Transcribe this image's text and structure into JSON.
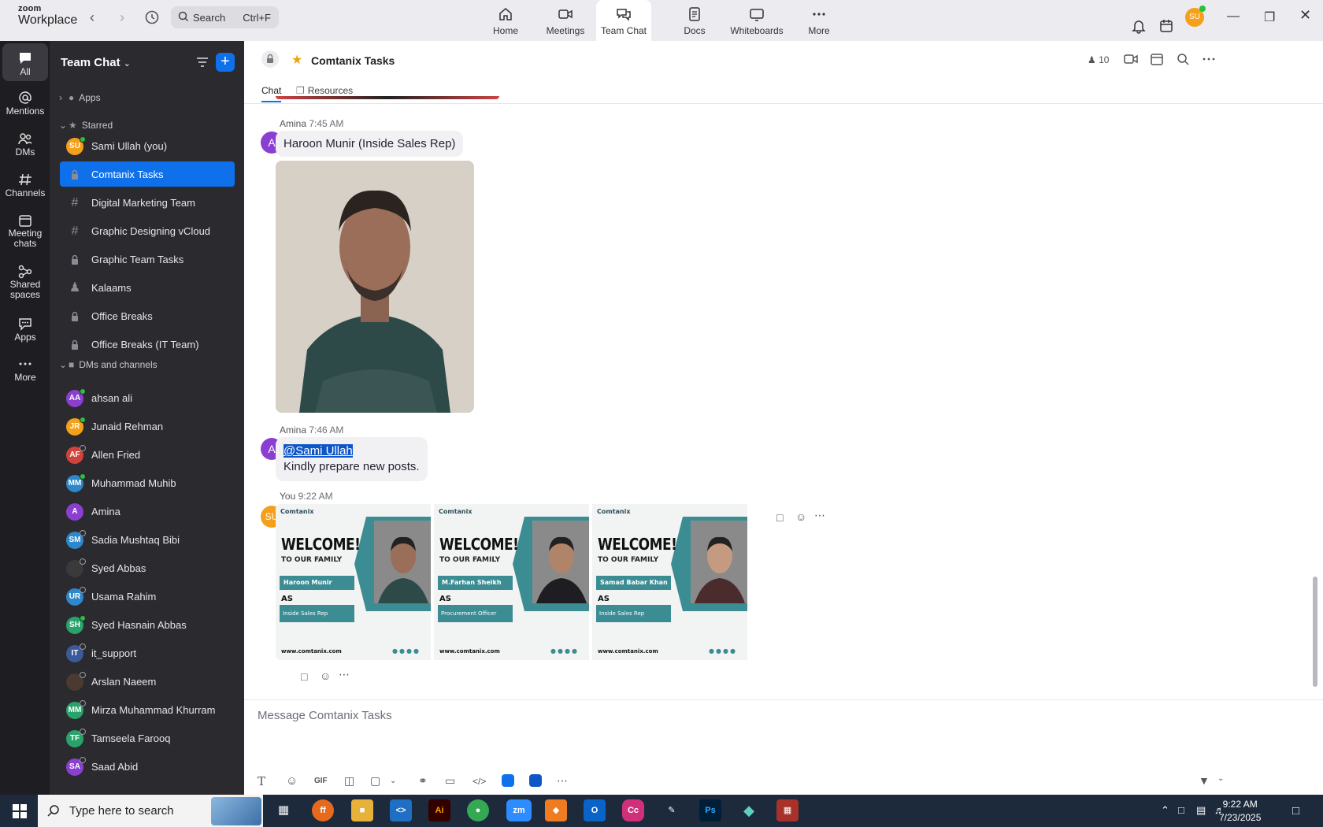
{
  "app": {
    "brand_top": "zoom",
    "brand_bottom": "Workplace"
  },
  "search": {
    "label": "Search",
    "shortcut": "Ctrl+F"
  },
  "top_tabs": [
    {
      "label": "Home",
      "icon": "home-icon"
    },
    {
      "label": "Meetings",
      "icon": "video-icon"
    },
    {
      "label": "Team Chat",
      "icon": "chat-icon",
      "active": true
    },
    {
      "label": "Docs",
      "icon": "doc-icon"
    },
    {
      "label": "Whiteboards",
      "icon": "whiteboard-icon"
    },
    {
      "label": "More",
      "icon": "more-icon"
    }
  ],
  "user_avatar": "SU",
  "rail": [
    {
      "label": "All",
      "icon": "chat-bubble-icon"
    },
    {
      "label": "Mentions",
      "icon": "at-icon"
    },
    {
      "label": "DMs",
      "icon": "people-icon"
    },
    {
      "label": "Channels",
      "icon": "hash-icon"
    },
    {
      "label": "Meeting chats",
      "icon": "calendar-icon"
    },
    {
      "label": "Shared spaces",
      "icon": "share-icon"
    },
    {
      "label": "Apps",
      "icon": "apps-icon"
    },
    {
      "label": "More",
      "icon": "more-icon"
    }
  ],
  "sidebar": {
    "title": "Team Chat",
    "sections": {
      "apps": "Apps",
      "starred": "Starred",
      "dms": "DMs and channels"
    },
    "starred": [
      {
        "label": "Sami Ullah (you)",
        "initials": "SU",
        "color": "#f5a01a",
        "status": "online"
      },
      {
        "label": "Comtanix Tasks",
        "glyph": "lock",
        "selected": true
      },
      {
        "label": "Digital Marketing Team",
        "glyph": "#"
      },
      {
        "label": "Graphic Designing vCloud",
        "glyph": "#"
      },
      {
        "label": "Graphic Team Tasks",
        "glyph": "lock"
      },
      {
        "label": "Kalaams",
        "glyph": "group"
      },
      {
        "label": "Office Breaks",
        "glyph": "lock"
      },
      {
        "label": "Office Breaks (IT Team)",
        "glyph": "lock"
      }
    ],
    "dms": [
      {
        "label": "ahsan ali",
        "initials": "AA",
        "color": "#8b3fd1",
        "status": "online"
      },
      {
        "label": "Junaid Rehman",
        "initials": "JR",
        "color": "#f5a01a",
        "status": "online"
      },
      {
        "label": "Allen Fried",
        "initials": "AF",
        "color": "#d0433a",
        "status": "offline"
      },
      {
        "label": "Muhammad Muhib",
        "initials": "MM",
        "color": "#2d87c9",
        "status": "online"
      },
      {
        "label": "Amina",
        "initials": "A",
        "color": "#8b3fd1",
        "status": ""
      },
      {
        "label": "Sadia Mushtaq Bibi",
        "initials": "SM",
        "color": "#2d87c9",
        "status": "mobile"
      },
      {
        "label": "Syed Abbas",
        "initials": "",
        "color": "#3a3a3a",
        "status": "offline"
      },
      {
        "label": "Usama Rahim",
        "initials": "UR",
        "color": "#2d87c9",
        "status": "offline"
      },
      {
        "label": "Syed Hasnain Abbas",
        "initials": "SH",
        "color": "#29a36a",
        "status": "online"
      },
      {
        "label": "it_support",
        "initials": "IT",
        "color": "#3b5a9a",
        "status": "mobile"
      },
      {
        "label": "Arslan Naeem",
        "initials": "",
        "color": "#4a3a30",
        "status": "offline"
      },
      {
        "label": "Mirza Muhammad Khurram",
        "initials": "MM",
        "color": "#29a36a",
        "status": "offline"
      },
      {
        "label": "Tamseela Farooq",
        "initials": "TF",
        "color": "#29a36a",
        "status": "offline"
      },
      {
        "label": "Saad Abid",
        "initials": "SA",
        "color": "#8b3fd1",
        "status": "offline"
      }
    ]
  },
  "channel": {
    "name": "Comtanix Tasks",
    "tabs": [
      "Chat",
      "Resources"
    ],
    "member_count": "10"
  },
  "messages": [
    {
      "sender": "Amina",
      "time": "7:45 AM",
      "avatar": "A",
      "text": "Haroon Munir (Inside Sales Rep)"
    },
    {
      "sender": "Amina",
      "time": "7:46 AM",
      "avatar": "A",
      "mention": "@Sami Ullah",
      "text": "Kindly prepare new posts."
    },
    {
      "sender": "You",
      "time": "9:22 AM",
      "avatar": "SU"
    }
  ],
  "cards": [
    {
      "brand": "Comtanix",
      "welcome": "WELCOME!",
      "family": "TO OUR FAMILY",
      "name": "Haroon Munir",
      "as": "AS",
      "role": "Inside Sales Rep",
      "web": "www.comtanix.com"
    },
    {
      "brand": "Comtanix",
      "welcome": "WELCOME!",
      "family": "TO OUR FAMILY",
      "name": "M.Farhan Sheikh",
      "as": "AS",
      "role": "Procurement Officer",
      "web": "www.comtanix.com"
    },
    {
      "brand": "Comtanix",
      "welcome": "WELCOME!",
      "family": "TO OUR FAMILY",
      "name": "Samad Babar Khan",
      "as": "AS",
      "role": "Inside Sales Rep",
      "web": "www.comtanix.com"
    }
  ],
  "composer": {
    "placeholder": "Message Comtanix Tasks"
  },
  "taskbar": {
    "search_placeholder": "Type here to search",
    "time": "9:22 AM",
    "date": "7/23/2025"
  },
  "colors": {
    "accent": "#0e71eb",
    "teal": "#3c8d93"
  }
}
